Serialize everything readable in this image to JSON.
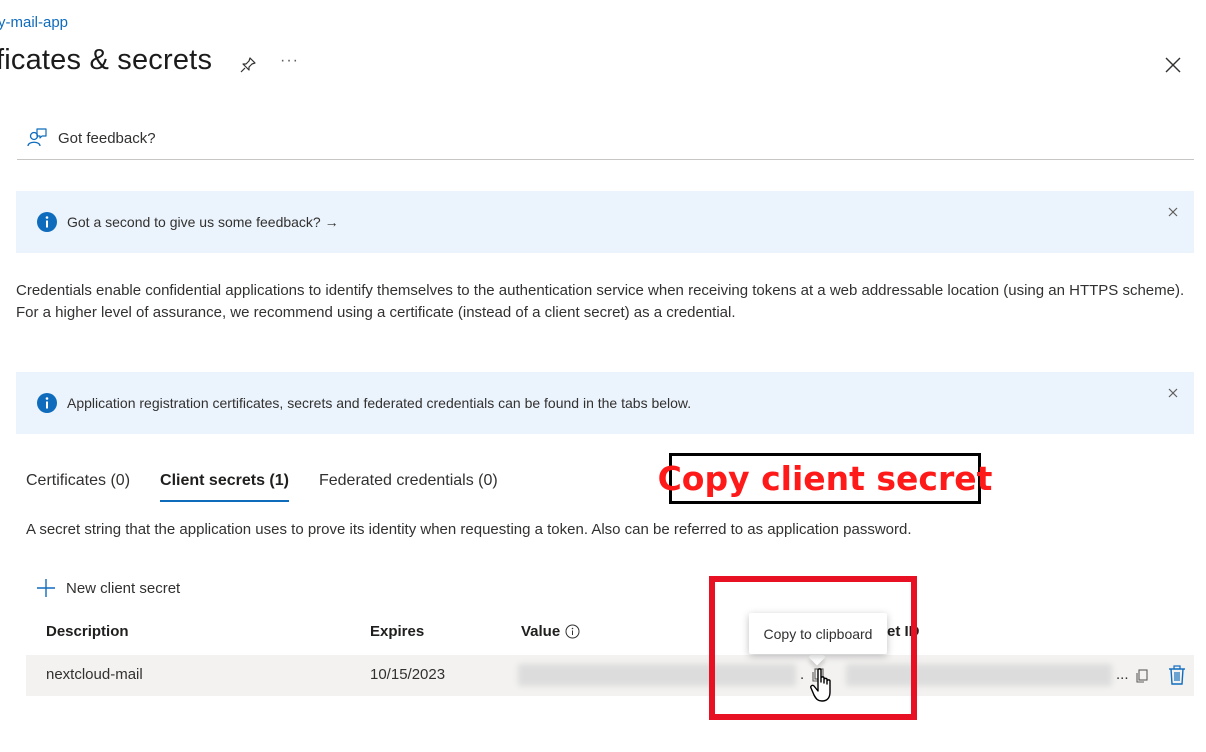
{
  "header": {
    "breadcrumb": "y-mail-app",
    "title": "ficates & secrets",
    "more": "···"
  },
  "toolbar": {
    "feedback_label": "Got feedback?"
  },
  "banners": [
    {
      "text": "Got a second to give us some feedback? →"
    },
    {
      "text": "Application registration certificates, secrets and federated credentials can be found in the tabs below."
    }
  ],
  "description": "Credentials enable confidential applications to identify themselves to the authentication service when receiving tokens at a web addressable location (using an HTTPS scheme). For a higher level of assurance, we recommend using a certificate (instead of a client secret) as a credential.",
  "tabs": [
    {
      "label": "Certificates (0)",
      "active": false
    },
    {
      "label": "Client secrets (1)",
      "active": true
    },
    {
      "label": "Federated credentials (0)",
      "active": false
    }
  ],
  "annotation": {
    "label": "Copy client secret",
    "color": "#ff1a1a",
    "highlight_color": "#e81123"
  },
  "secrets_section": {
    "description": "A secret string that the application uses to prove its identity when requesting a token. Also can be referred to as application password.",
    "new_button": "New client secret",
    "columns": {
      "description": "Description",
      "expires": "Expires",
      "value": "Value",
      "secret_id_partial": "et ID"
    },
    "rows": [
      {
        "description": "nextcloud-mail",
        "expires": "10/15/2023",
        "value_ellipsis": ".",
        "id_ellipsis": "..."
      }
    ],
    "tooltip": "Copy to clipboard"
  },
  "colors": {
    "accent": "#0f6cbd",
    "banner_bg": "#ebf3fc",
    "row_bg": "#f3f2f1"
  },
  "icons": [
    "pin-icon",
    "more-icon",
    "close-icon",
    "feedback-icon",
    "info-icon",
    "dismiss-icon",
    "add-icon",
    "value-info-icon",
    "copy-icon",
    "delete-icon",
    "cursor-hand-icon"
  ]
}
